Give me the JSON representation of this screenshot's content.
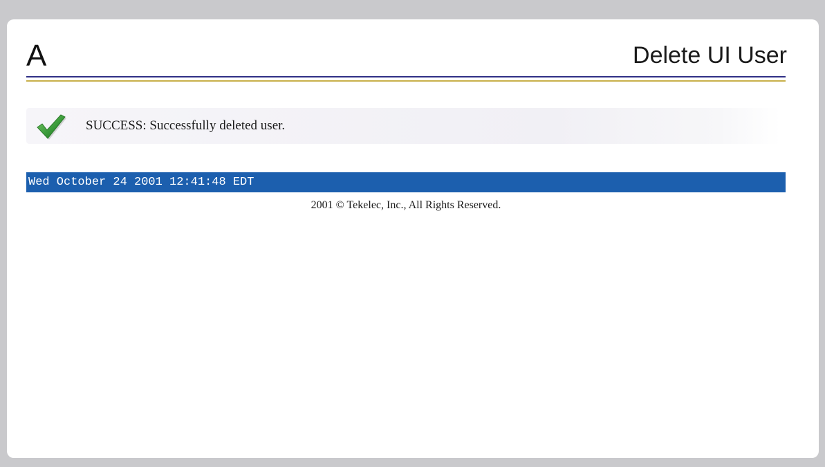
{
  "header": {
    "logo_letter": "A",
    "title": "Delete UI User"
  },
  "message": {
    "icon": "checkmark-icon",
    "icon_color": "#3a9a3a",
    "text": "SUCCESS: Successfully deleted user."
  },
  "footer": {
    "timestamp": "Wed October 24 2001 12:41:48 EDT",
    "timestamp_bar_color": "#1c5fae",
    "copyright": "2001 © Tekelec, Inc., All Rights Reserved."
  }
}
